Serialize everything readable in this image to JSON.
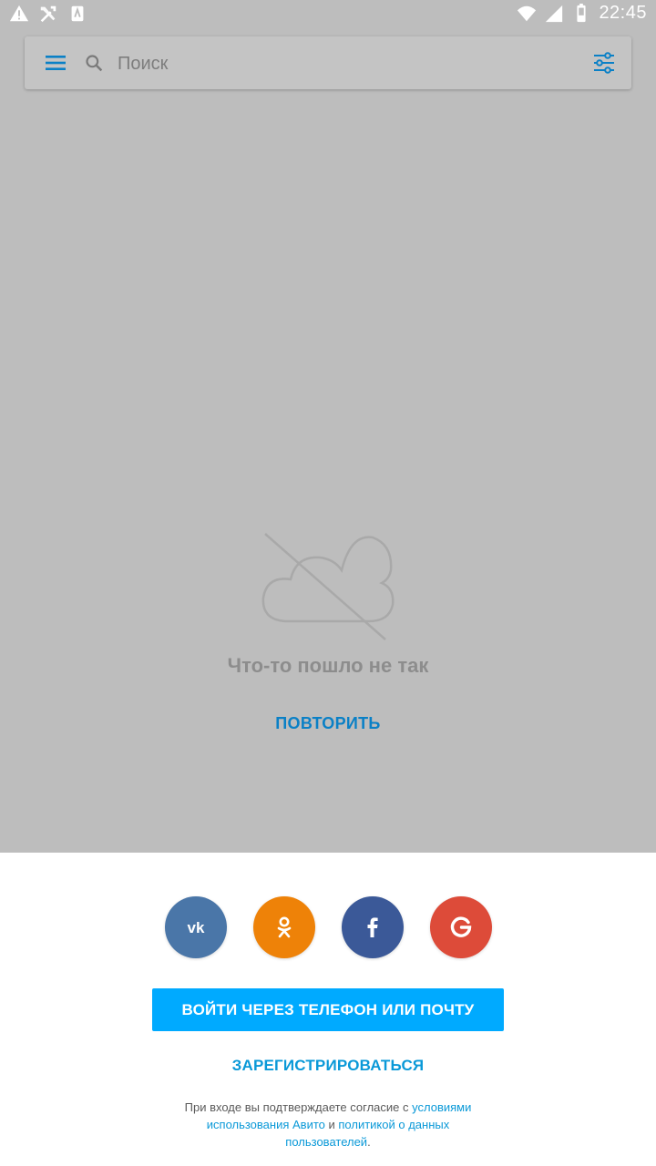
{
  "status_bar": {
    "time": "22:45"
  },
  "search": {
    "placeholder": "Поиск"
  },
  "error": {
    "message": "Что-то пошло не так",
    "retry_label": "ПОВТОРИТЬ"
  },
  "auth": {
    "social": [
      {
        "name": "vk",
        "color": "#4a76a8"
      },
      {
        "name": "ok",
        "color": "#ee8208"
      },
      {
        "name": "facebook",
        "color": "#3b5998"
      },
      {
        "name": "google",
        "color": "#dd4b39"
      }
    ],
    "login_label": "ВОЙТИ ЧЕРЕЗ ТЕЛЕФОН ИЛИ ПОЧТУ",
    "register_label": "ЗАРЕГИСТРИРОВАТЬСЯ",
    "legal": {
      "prefix": "При входе вы подтверждаете согласие с ",
      "terms_link": "условиями использования Авито",
      "middle": " и ",
      "privacy_link": "политикой о данных пользователей",
      "suffix": "."
    }
  },
  "colors": {
    "overlay": "#bdbdbd",
    "accent": "#00aaff",
    "link": "#0a99d8"
  }
}
